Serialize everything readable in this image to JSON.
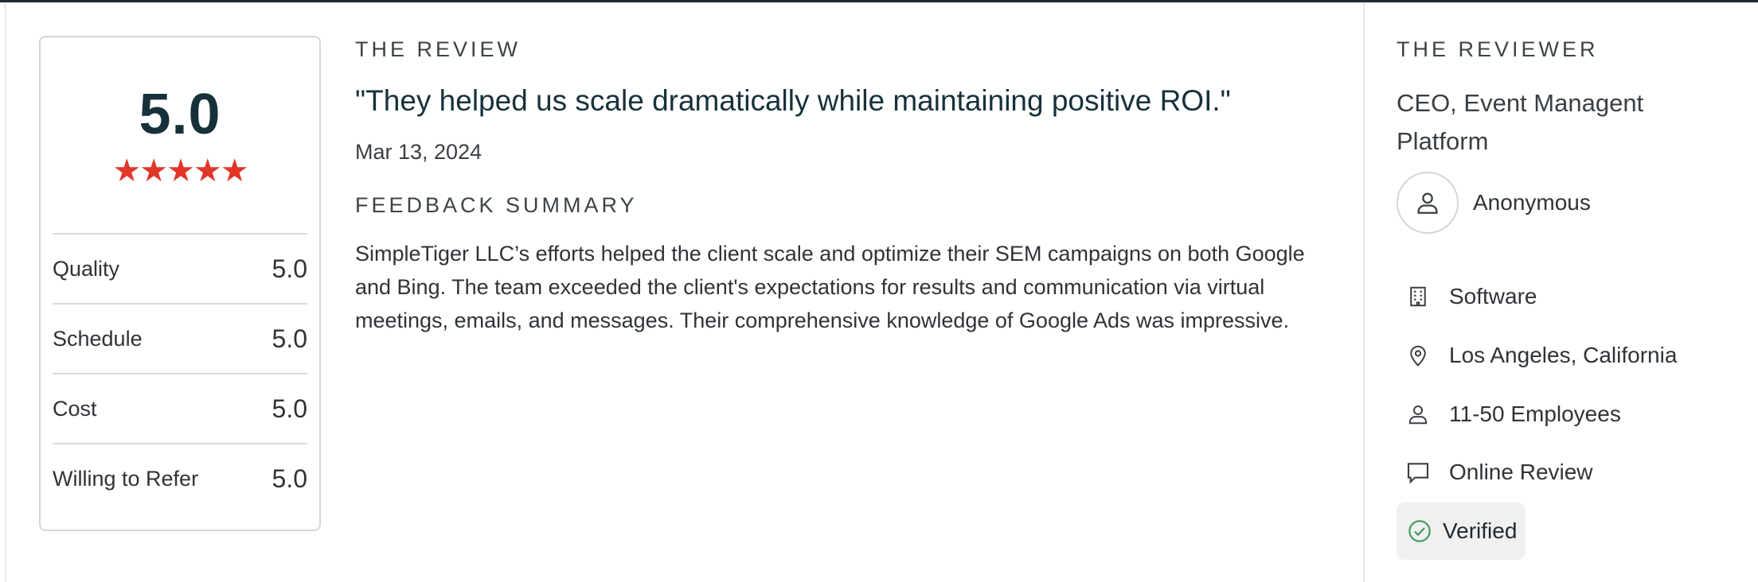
{
  "rating": {
    "overall": "5.0",
    "stars": "★★★★★",
    "star_count": 5,
    "rows": [
      {
        "label": "Quality",
        "value": "5.0"
      },
      {
        "label": "Schedule",
        "value": "5.0"
      },
      {
        "label": "Cost",
        "value": "5.0"
      },
      {
        "label": "Willing to Refer",
        "value": "5.0"
      }
    ]
  },
  "review": {
    "heading": "THE REVIEW",
    "quote": "\"They helped us scale dramatically while maintaining positive ROI.\"",
    "date": "Mar 13, 2024",
    "summary_heading": "FEEDBACK SUMMARY",
    "summary": "SimpleTiger LLC’s efforts helped the client scale and optimize their SEM campaigns on both Google and Bing. The team exceeded the client's expectations for results and communication via virtual meetings, emails, and messages. Their comprehensive knowledge of Google Ads was impressive."
  },
  "reviewer": {
    "heading": "THE REVIEWER",
    "title": "CEO, Event Managent Platform",
    "name": "Anonymous",
    "details": [
      {
        "icon": "building-icon",
        "text": "Software"
      },
      {
        "icon": "location-pin-icon",
        "text": "Los Angeles, California"
      },
      {
        "icon": "person-icon",
        "text": "11-50 Employees"
      },
      {
        "icon": "chat-bubble-icon",
        "text": "Online Review"
      }
    ],
    "verified_label": "Verified"
  },
  "colors": {
    "star": "#e2362b",
    "score": "#17313b",
    "verified_check": "#3e9b5c"
  }
}
